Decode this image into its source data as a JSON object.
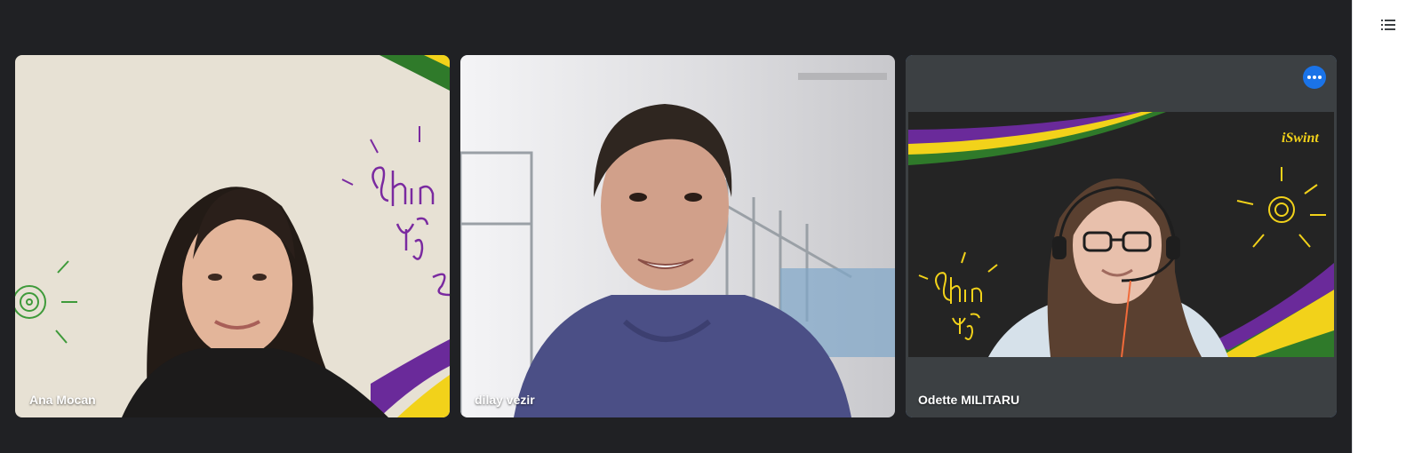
{
  "participants": [
    {
      "name": "Ana Mocan",
      "background_text": "Shine your own light"
    },
    {
      "name": "dilay vezir"
    },
    {
      "name": "Odette MILITARU",
      "background_text": "Shine your own light",
      "logo_text": "iSwint",
      "active_speaker": true
    }
  ],
  "colors": {
    "stage_bg": "#202124",
    "tile_bg": "#3c4043",
    "active_border": "#5b8fd8",
    "more_button": "#1a73e8",
    "brand_purple": "#6a2a9a",
    "brand_yellow": "#f2d21a",
    "brand_green": "#2f7a2a"
  },
  "icons": {
    "more_options": "more-horiz-icon",
    "sidebar_list": "list-icon"
  }
}
